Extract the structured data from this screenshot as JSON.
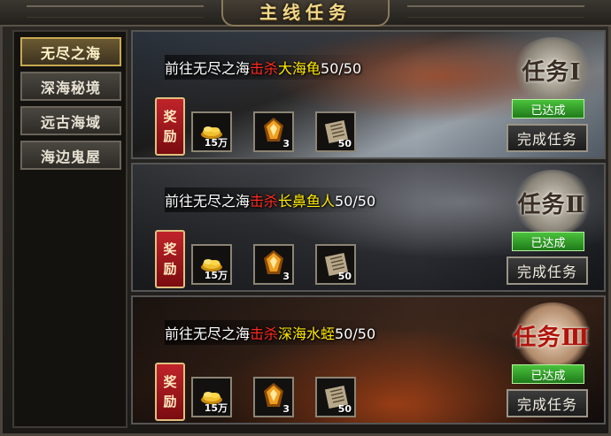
{
  "title": "主线任务",
  "sidebar": {
    "tabs": [
      {
        "label": "无尽之海",
        "active": true
      },
      {
        "label": "深海秘境",
        "active": false
      },
      {
        "label": "远古海域",
        "active": false
      },
      {
        "label": "海边鬼屋",
        "active": false
      }
    ]
  },
  "quests": [
    {
      "prefix": "前往无尽之海",
      "action": "击杀",
      "target": "大海龟",
      "progress": "50/50",
      "reward_label_top": "奖",
      "reward_label_bottom": "励",
      "rewards": [
        {
          "icon": "gold-coins-icon",
          "qty": "15万"
        },
        {
          "icon": "orange-gem-icon",
          "qty": "3"
        },
        {
          "icon": "scroll-icon",
          "qty": "50"
        }
      ],
      "medal": "任务Ⅰ",
      "status": "已达成",
      "button": "完成任务"
    },
    {
      "prefix": "前往无尽之海",
      "action": "击杀",
      "target": "长鼻鱼人",
      "progress": "50/50",
      "reward_label_top": "奖",
      "reward_label_bottom": "励",
      "rewards": [
        {
          "icon": "gold-coins-icon",
          "qty": "15万"
        },
        {
          "icon": "orange-gem-icon",
          "qty": "3"
        },
        {
          "icon": "scroll-icon",
          "qty": "50"
        }
      ],
      "medal": "任务Ⅱ",
      "status": "已达成",
      "button": "完成任务"
    },
    {
      "prefix": "前往无尽之海",
      "action": "击杀",
      "target": "深海水蛭",
      "progress": "50/50",
      "reward_label_top": "奖",
      "reward_label_bottom": "励",
      "rewards": [
        {
          "icon": "gold-coins-icon",
          "qty": "15万"
        },
        {
          "icon": "orange-gem-icon",
          "qty": "3"
        },
        {
          "icon": "scroll-icon",
          "qty": "50"
        }
      ],
      "medal": "任务Ⅲ",
      "status": "已达成",
      "button": "完成任务"
    }
  ],
  "colors": {
    "accent_gold": "#f2d98a",
    "kill_red": "#ff2a1f",
    "target_yellow": "#ffea00",
    "status_green": "#4ac23c",
    "reward_red": "#c0242a"
  }
}
